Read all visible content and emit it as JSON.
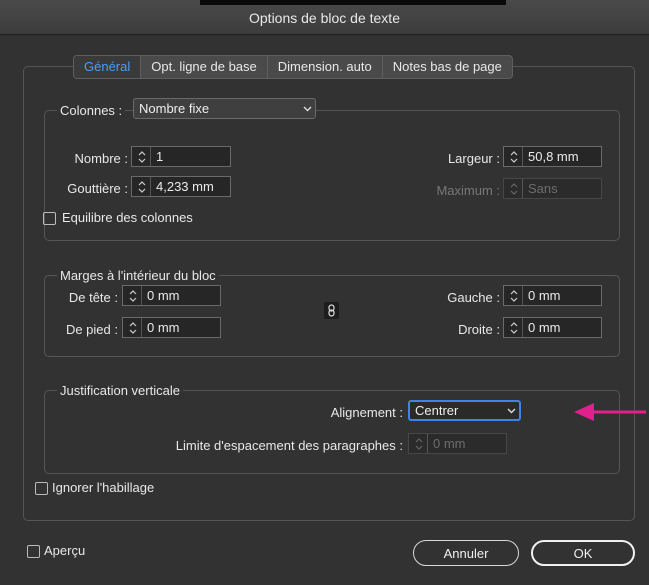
{
  "window": {
    "title": "Options de bloc de texte"
  },
  "tabs": [
    {
      "label": "Général",
      "active": true
    },
    {
      "label": "Opt. ligne de base",
      "active": false
    },
    {
      "label": "Dimension. auto",
      "active": false
    },
    {
      "label": "Notes bas de page",
      "active": false
    }
  ],
  "columns": {
    "label": "Colonnes :",
    "mode": "Nombre fixe",
    "number_label": "Nombre :",
    "number_value": "1",
    "gutter_label": "Gouttière :",
    "gutter_value": "4,233 mm",
    "width_label": "Largeur :",
    "width_value": "50,8 mm",
    "max_label": "Maximum :",
    "max_value": "Sans",
    "balance_label": "Equilibre des colonnes",
    "balance_checked": false
  },
  "insets": {
    "title": "Marges à l'intérieur du bloc",
    "top_label": "De tête :",
    "top_value": "0 mm",
    "bottom_label": "De pied :",
    "bottom_value": "0 mm",
    "left_label": "Gauche :",
    "left_value": "0 mm",
    "right_label": "Droite :",
    "right_value": "0 mm",
    "link_icon": "chain-link-icon"
  },
  "vertical": {
    "title": "Justification verticale",
    "align_label": "Alignement :",
    "align_value": "Centrer",
    "limit_label": "Limite d'espacement des paragraphes :",
    "limit_value": "0 mm"
  },
  "ignore_wrap": {
    "label": "Ignorer l'habillage",
    "checked": false
  },
  "footer": {
    "preview_label": "Aperçu",
    "cancel_label": "Annuler",
    "ok_label": "OK"
  },
  "annotation": {
    "arrow_color": "#e0208c"
  },
  "colors": {
    "accent": "#4a9dfc",
    "focus": "#3b86e8"
  }
}
